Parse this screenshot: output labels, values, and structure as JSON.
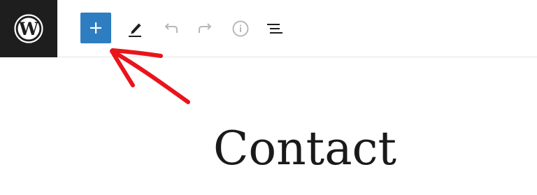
{
  "toolbar": {
    "logo_icon": "wordpress-logo-icon",
    "add_block_icon": "plus-icon",
    "tools": [
      {
        "name": "edit-tool",
        "icon": "pencil-icon"
      },
      {
        "name": "undo",
        "icon": "undo-icon"
      },
      {
        "name": "redo",
        "icon": "redo-icon"
      },
      {
        "name": "details",
        "icon": "info-icon"
      },
      {
        "name": "list-view",
        "icon": "list-view-icon"
      }
    ]
  },
  "post": {
    "title": "Contact"
  },
  "annotation": {
    "type": "red-arrow-pointing-to-add-block-button",
    "color": "#e8151b"
  },
  "colors": {
    "logo_background": "#1e1e1e",
    "accent": "#2f7dc1",
    "icon_active": "#1e1e1e",
    "icon_disabled": "#b8b8b8"
  }
}
